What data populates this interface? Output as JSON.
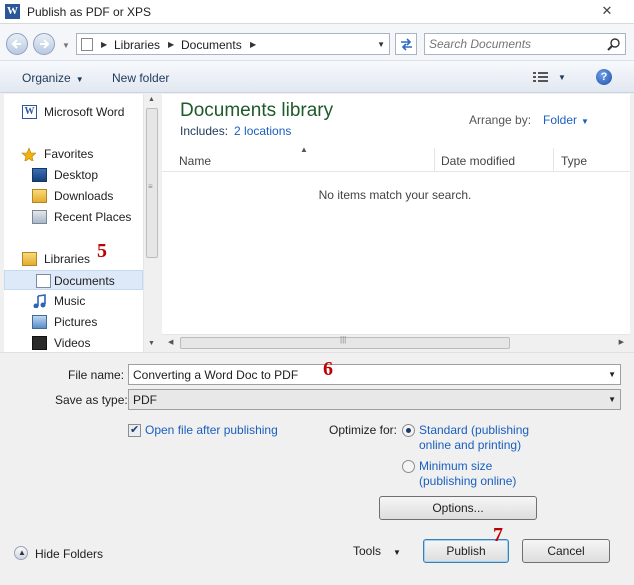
{
  "window": {
    "title": "Publish as PDF or XPS",
    "app_icon_letter": "W",
    "close_glyph": "✕"
  },
  "address": {
    "crumbs": [
      "Libraries",
      "Documents"
    ],
    "search_placeholder": "Search Documents"
  },
  "toolbar": {
    "organize": "Organize",
    "new_folder": "New folder"
  },
  "nav": {
    "items": [
      {
        "label": "Microsoft Word",
        "icon": "word-icon"
      },
      {
        "label": "Favorites",
        "icon": "star-icon"
      },
      {
        "label": "Desktop",
        "icon": "desktop-icon"
      },
      {
        "label": "Downloads",
        "icon": "downloads-folder-icon"
      },
      {
        "label": "Recent Places",
        "icon": "recent-places-icon"
      },
      {
        "label": "Libraries",
        "icon": "libraries-icon"
      },
      {
        "label": "Documents",
        "icon": "document-icon",
        "selected": true
      },
      {
        "label": "Music",
        "icon": "music-note-icon"
      },
      {
        "label": "Pictures",
        "icon": "pictures-icon"
      },
      {
        "label": "Videos",
        "icon": "video-film-icon"
      }
    ]
  },
  "annotations": {
    "step5": "5",
    "step6": "6",
    "step7": "7"
  },
  "library": {
    "title": "Documents library",
    "includes_label": "Includes:",
    "includes_link": "2 locations",
    "arrange_label": "Arrange by:",
    "arrange_value": "Folder"
  },
  "columns": [
    "Name",
    "Date modified",
    "Type"
  ],
  "empty_message": "No items match your search.",
  "form": {
    "file_name_label": "File name:",
    "file_name_value": "Converting a Word Doc to PDF",
    "save_as_label": "Save as type:",
    "save_as_value": "PDF",
    "open_after_label": "Open file after publishing",
    "open_after_checked": true,
    "optimize_label": "Optimize for:",
    "optimize_standard_line1": "Standard (publishing",
    "optimize_standard_line2": "online and printing)",
    "optimize_minimum_line1": "Minimum size",
    "optimize_minimum_line2": "(publishing online)",
    "optimize_selected": "standard"
  },
  "buttons": {
    "options": "Options...",
    "tools": "Tools",
    "publish": "Publish",
    "cancel": "Cancel",
    "hide_folders": "Hide Folders"
  },
  "colors": {
    "accent_blue": "#1a5fbf",
    "library_title_green": "#1e5a2a",
    "annotation_red": "#c00000"
  }
}
